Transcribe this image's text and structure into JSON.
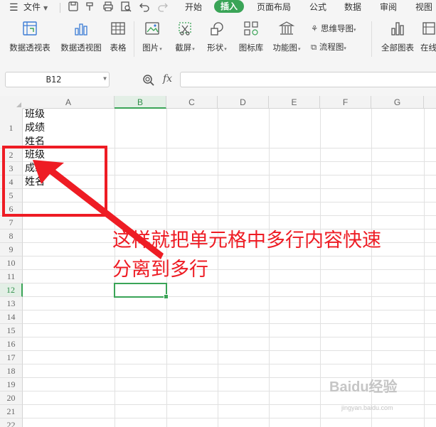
{
  "menubar": {
    "file_label": "文件",
    "tabs": [
      "开始",
      "插入",
      "页面布局",
      "公式",
      "数据",
      "审阅",
      "视图"
    ],
    "active_tab": "插入"
  },
  "ribbon": {
    "pivot_table": "数据透视表",
    "pivot_chart": "数据透视图",
    "table": "表格",
    "picture": "图片",
    "screenshot": "截屏",
    "shape": "形状",
    "icon_library": "图标库",
    "function_chart": "功能图",
    "mind_map": "思维导图",
    "flow_chart": "流程图",
    "all_charts": "全部图表",
    "online": "在线"
  },
  "formula_bar": {
    "cell_ref": "B12",
    "fx": "fx",
    "formula": ""
  },
  "sheet": {
    "columns": [
      "A",
      "B",
      "C",
      "D",
      "E",
      "F",
      "G"
    ],
    "selected_column": "B",
    "rows": [
      "1",
      "2",
      "3",
      "4",
      "5",
      "6",
      "7",
      "8",
      "9",
      "10",
      "11",
      "12",
      "13",
      "14",
      "15",
      "16",
      "17",
      "18",
      "19",
      "20",
      "21",
      "22"
    ],
    "selected_row": "12",
    "cell_a1_lines": [
      "班级",
      "成绩",
      "姓名"
    ],
    "a2": "班级",
    "a3": "成绩",
    "a4": "姓名"
  },
  "annotation": {
    "line1": "这样就把单元格中多行内容快速",
    "line2": "分离到多行",
    "color": "#ee1c24"
  },
  "watermark": {
    "brand": "Baidu经验",
    "url": "jingyan.baidu.com"
  }
}
